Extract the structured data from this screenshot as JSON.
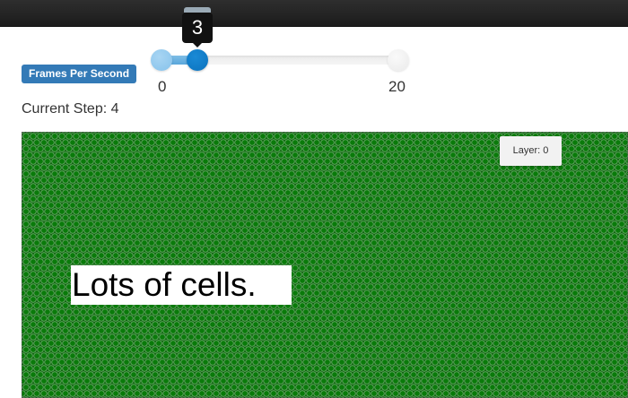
{
  "fps": {
    "label": "Frames Per Second",
    "min": 0,
    "max": 20,
    "value": 3,
    "min_label": "0",
    "max_label": "20",
    "tooltip": "3"
  },
  "status": {
    "current_step": "Current Step: 4"
  },
  "grid": {
    "layer_label": "Layer: 0",
    "caption": "Lots of cells.",
    "cell_color": "#0a7a0a",
    "cell_border_color": "#76b876"
  },
  "colors": {
    "accent": "#337ab7",
    "slider_handle": "#0b72bd",
    "slider_fill": "#5aa7db"
  }
}
